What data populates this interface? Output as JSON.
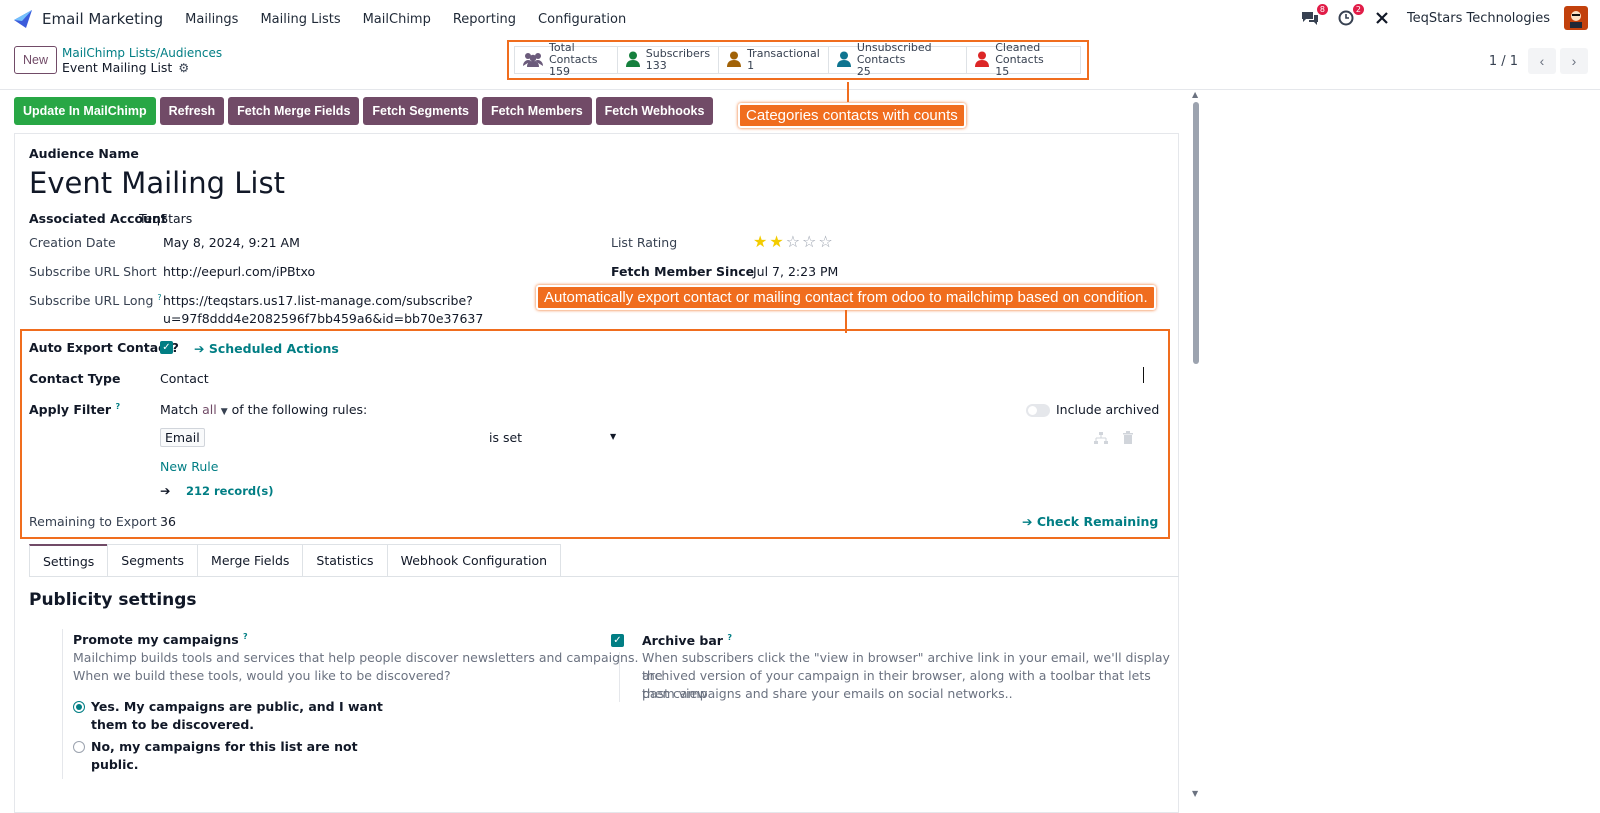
{
  "topbar": {
    "app_name": "Email Marketing",
    "menu": [
      "Mailings",
      "Mailing Lists",
      "MailChimp",
      "Reporting",
      "Configuration"
    ],
    "chat_badge": "8",
    "activity_badge": "2",
    "company": "TeqStars Technologies"
  },
  "control": {
    "new_label": "New",
    "breadcrumb_parent": "MailChimp Lists/Audiences",
    "breadcrumb_current": "Event Mailing List",
    "pager": "1 / 1"
  },
  "stats": [
    {
      "label": "Total Contacts",
      "value": "159",
      "color": "#6b5b7b"
    },
    {
      "label": "Subscribers",
      "value": "133",
      "color": "#15803d"
    },
    {
      "label": "Transactional",
      "value": "1",
      "color": "#a16207"
    },
    {
      "label": "Unsubscribed Contacts",
      "value": "25",
      "color": "#0e7490"
    },
    {
      "label": "Cleaned Contacts",
      "value": "15",
      "color": "#dc2626"
    }
  ],
  "actions": {
    "update": "Update In MailChimp",
    "refresh": "Refresh",
    "merge": "Fetch Merge Fields",
    "segments": "Fetch Segments",
    "members": "Fetch Members",
    "webhooks": "Fetch Webhooks"
  },
  "callouts": {
    "stats": "Categories contacts with counts",
    "export": "Automatically export contact or mailing contact from odoo to mailchimp based on condition."
  },
  "form": {
    "audience_label": "Audience Name",
    "audience_name": "Event Mailing List",
    "account_label": "Associated Account",
    "account_value": "TeqStars",
    "creation_label": "Creation Date",
    "creation_value": "May 8, 2024, 9:21 AM",
    "short_label": "Subscribe URL Short",
    "short_value": "http://eepurl.com/iPBtxo",
    "long_label": "Subscribe URL Long",
    "long_value_1": "https://teqstars.us17.list-manage.com/subscribe?",
    "long_value_2": "u=97f8ddd4e2082596f7bb459a6&id=bb70e37637",
    "rating_label": "List Rating",
    "rating": 2,
    "fetch_label": "Fetch Member Since",
    "fetch_value": "Jul 7, 2:23 PM"
  },
  "export": {
    "auto_label": "Auto Export Contact?",
    "scheduled": "Scheduled Actions",
    "type_label": "Contact Type",
    "type_value": "Contact",
    "filter_label": "Apply Filter",
    "match": "Match",
    "match_all": "all",
    "match_rest": "of the following rules:",
    "include_archived": "Include archived",
    "rule_field": "Email",
    "rule_op": "is set",
    "new_rule": "New Rule",
    "records": "212 record(s)",
    "remaining_label": "Remaining to Export",
    "remaining_value": "36",
    "check": "Check Remaining"
  },
  "tabs": [
    "Settings",
    "Segments",
    "Merge Fields",
    "Statistics",
    "Webhook Configuration"
  ],
  "publicity": {
    "title": "Publicity settings",
    "promote_label": "Promote my campaigns",
    "promote_desc_1": "Mailchimp builds tools and services that help people discover newsletters and campaigns.",
    "promote_desc_2": "When we build these tools, would you like to be discovered?",
    "yes_1": "Yes. My campaigns are public, and I want",
    "yes_2": "them to be discovered.",
    "no_1": "No, my campaigns for this list are not",
    "no_2": "public.",
    "archive_label": "Archive bar",
    "archive_desc_1": "When subscribers click the \"view in browser\" archive link in your email, we'll display the",
    "archive_desc_2": "archived version of your campaign in their browser, along with a toolbar that lets them view",
    "archive_desc_3": "past campaigns and share your emails on social networks.."
  }
}
